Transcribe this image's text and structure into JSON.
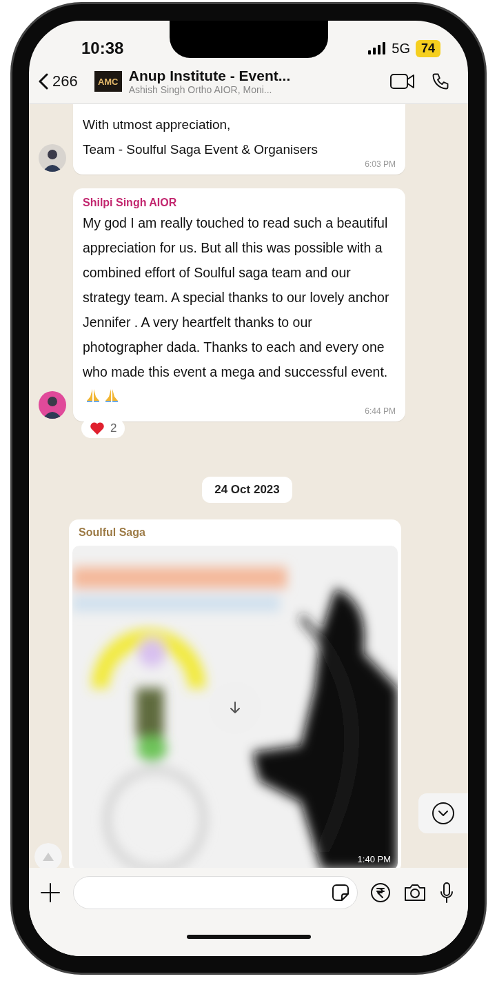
{
  "status_bar": {
    "time": "10:38",
    "network": "5G",
    "battery": "74"
  },
  "header": {
    "back_count": "266",
    "avatar_text": "AMC",
    "title": "Anup Institute - Event...",
    "subtitle": "Ashish Singh Ortho AIOR, Moni..."
  },
  "messages": [
    {
      "kind": "text",
      "lines": [
        "With utmost appreciation,",
        "Team - Soulful Saga Event & Organisers"
      ],
      "time": "6:03 PM"
    },
    {
      "kind": "text",
      "sender": "Shilpi Singh AIOR",
      "color": "#c2266e",
      "text": "My god I am really touched to read such a beautiful appreciation for us. But all this was possible with a combined effort of Soulful saga team and our strategy team. A special thanks to our lovely anchor Jennifer . A very heartfelt thanks to our photographer dada. Thanks to each and every one who made this event a mega and successful event.",
      "trailing_emoji": [
        {
          "kind": "praying-hands"
        },
        {
          "kind": "praying-hands"
        }
      ],
      "time": "6:44 PM",
      "reaction": {
        "count": "2"
      }
    },
    {
      "kind": "date",
      "text": "24 Oct 2023"
    },
    {
      "kind": "media",
      "sender": "Soulful Saga",
      "color": "#9c7a45",
      "time": "1:40 PM"
    }
  ]
}
